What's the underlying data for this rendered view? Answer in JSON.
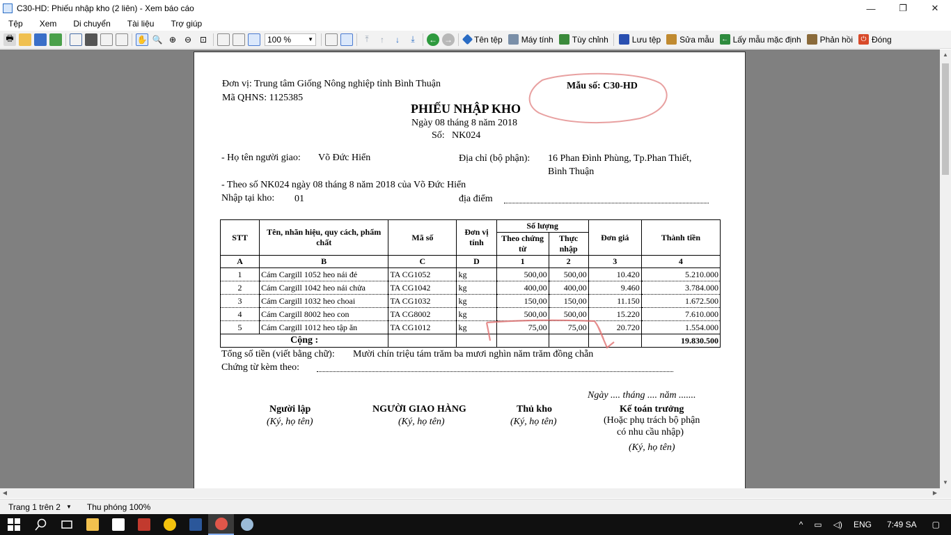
{
  "window": {
    "title": "C30-HD: Phiếu nhập kho (2 liên) - Xem báo cáo",
    "minimize": "—",
    "maximize": "❐",
    "close": "✕"
  },
  "menu": [
    "Tệp",
    "Xem",
    "Di chuyển",
    "Tài liệu",
    "Trợ giúp"
  ],
  "toolbar": {
    "zoom_value": "100 %",
    "buttons": [
      {
        "label": "Tên tệp",
        "icon": "diamond-icon",
        "color": "#2a6cc4"
      },
      {
        "label": "Máy tính",
        "icon": "calculator-icon",
        "color": "#7a8fa8"
      },
      {
        "label": "Tùy chỉnh",
        "icon": "customize-icon",
        "color": "#3b8a3b"
      },
      {
        "label": "Lưu tệp",
        "icon": "save-icon",
        "color": "#2a4fb0"
      },
      {
        "label": "Sửa mẫu",
        "icon": "edit-icon",
        "color": "#c08a30"
      },
      {
        "label": "Lấy mẫu mặc định",
        "icon": "back-arrow-icon",
        "color": "#2e8b3e"
      },
      {
        "label": "Phản hồi",
        "icon": "feedback-icon",
        "color": "#8a6a3a"
      },
      {
        "label": "Đóng",
        "icon": "power-icon",
        "color": "#d84a2a"
      }
    ]
  },
  "document": {
    "unit": "Đơn vị: Trung tâm Giống Nông nghiệp tỉnh Bình Thuận",
    "qhns": "Mã QHNS: 1125385",
    "form_code": "Mẫu số: C30-HD",
    "title": "PHIẾU NHẬP KHO",
    "date": "Ngày 08 tháng 8 năm 2018",
    "number_label": "Số:",
    "number": "NK024",
    "deliverer_label": "- Họ tên người giao:",
    "deliverer": "Võ Đức Hiển",
    "address_label": "Địa chỉ (bộ phận):",
    "address_line1": "16 Phan Đình Phùng, Tp.Phan Thiết,",
    "address_line2": "Bình Thuận",
    "reference": "- Theo số NK024 ngày 08 tháng 8 năm 2018 của Võ Đức Hiển",
    "warehouse_label": "Nhập tại kho:",
    "warehouse": "01",
    "location_label": "địa điểm",
    "table": {
      "headers": {
        "stt": "STT",
        "name": "Tên, nhãn hiệu, quy cách, phẩm chất",
        "code": "Mã số",
        "unit": "Đơn vị tính",
        "quantity": "Số lượng",
        "qty_doc": "Theo chứng từ",
        "qty_actual": "Thực nhập",
        "price": "Đơn giá",
        "amount": "Thành tiền"
      },
      "letters": [
        "A",
        "B",
        "C",
        "D",
        "1",
        "2",
        "3",
        "4"
      ],
      "rows": [
        {
          "stt": "1",
          "name": "Cám  Cargill 1052 heo nái đẻ",
          "code": "TA CG1052",
          "unit": "kg",
          "qty_doc": "500,00",
          "qty_actual": "500,00",
          "price": "10.420",
          "amount": "5.210.000"
        },
        {
          "stt": "2",
          "name": "Cám  Cargill 1042 heo nái chửa",
          "code": "TA CG1042",
          "unit": "kg",
          "qty_doc": "400,00",
          "qty_actual": "400,00",
          "price": "9.460",
          "amount": "3.784.000"
        },
        {
          "stt": "3",
          "name": "Cám Cargill 1032 heo choai",
          "code": "TA CG1032",
          "unit": "kg",
          "qty_doc": "150,00",
          "qty_actual": "150,00",
          "price": "11.150",
          "amount": "1.672.500"
        },
        {
          "stt": "4",
          "name": "Cám Cargill 8002 heo con",
          "code": "TA CG8002",
          "unit": "kg",
          "qty_doc": "500,00",
          "qty_actual": "500,00",
          "price": "15.220",
          "amount": "7.610.000"
        },
        {
          "stt": "5",
          "name": "Cám Cargill 1012 heo tập ăn",
          "code": "TA CG1012",
          "unit": "kg",
          "qty_doc": "75,00",
          "qty_actual": "75,00",
          "price": "20.720",
          "amount": "1.554.000"
        }
      ],
      "total_label": "Cộng :",
      "total_amount": "19.830.500"
    },
    "total_words_label": "Tổng số tiền (viết bằng chữ):",
    "total_words": "Mười chín triệu tám trăm ba mươi nghìn năm trăm đồng chẵn",
    "attachments_label": "Chứng từ kèm theo:",
    "date_placeholder": "Ngày .... tháng .... năm .......",
    "signatures": [
      {
        "title": "Người lập",
        "note": "(Ký, họ tên)"
      },
      {
        "title": "NGƯỜI GIAO HÀNG",
        "note": "(Ký, họ tên)"
      },
      {
        "title": "Thủ kho",
        "note": "(Ký, họ tên)"
      },
      {
        "title": "Kế toán trưởng",
        "sub1": "(Hoặc phụ trách bộ phận",
        "sub2": "có nhu cầu nhập)",
        "note": "(Ký, họ tên)"
      }
    ]
  },
  "status": {
    "page": "Trang 1 trên 2",
    "zoom": "Thu phóng 100%"
  },
  "taskbar": {
    "lang": "ENG",
    "time": "7:49 SA"
  }
}
